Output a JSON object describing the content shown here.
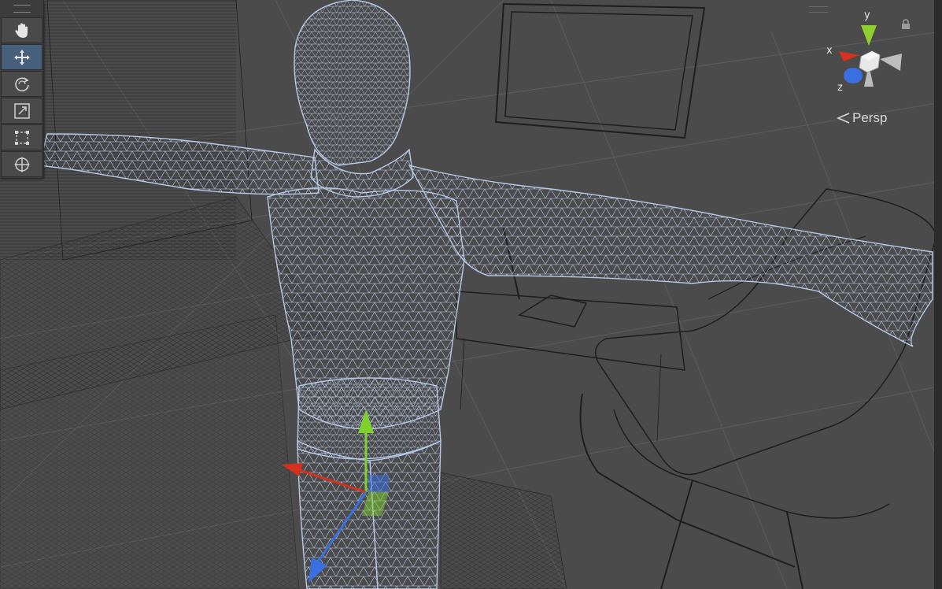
{
  "toolbar": {
    "tools": [
      {
        "name": "hand-tool",
        "icon": "hand-icon",
        "active": false
      },
      {
        "name": "move-tool",
        "icon": "move-arrows-icon",
        "active": true
      },
      {
        "name": "rotate-tool",
        "icon": "rotate-icon",
        "active": false
      },
      {
        "name": "scale-tool",
        "icon": "scale-icon",
        "active": false
      },
      {
        "name": "rect-tool",
        "icon": "rect-transform-icon",
        "active": false
      },
      {
        "name": "transform-tool",
        "icon": "transform-icon",
        "active": false
      }
    ]
  },
  "orientation_gizmo": {
    "x_label": "x",
    "y_label": "y",
    "z_label": "z",
    "projection_label": "Persp",
    "colors": {
      "x": "#d6301f",
      "y": "#8fcf31",
      "z": "#3a6fe0"
    }
  },
  "scene": {
    "wireframe_color": "#b7c9e6",
    "background_color": "#4b4b4b"
  }
}
